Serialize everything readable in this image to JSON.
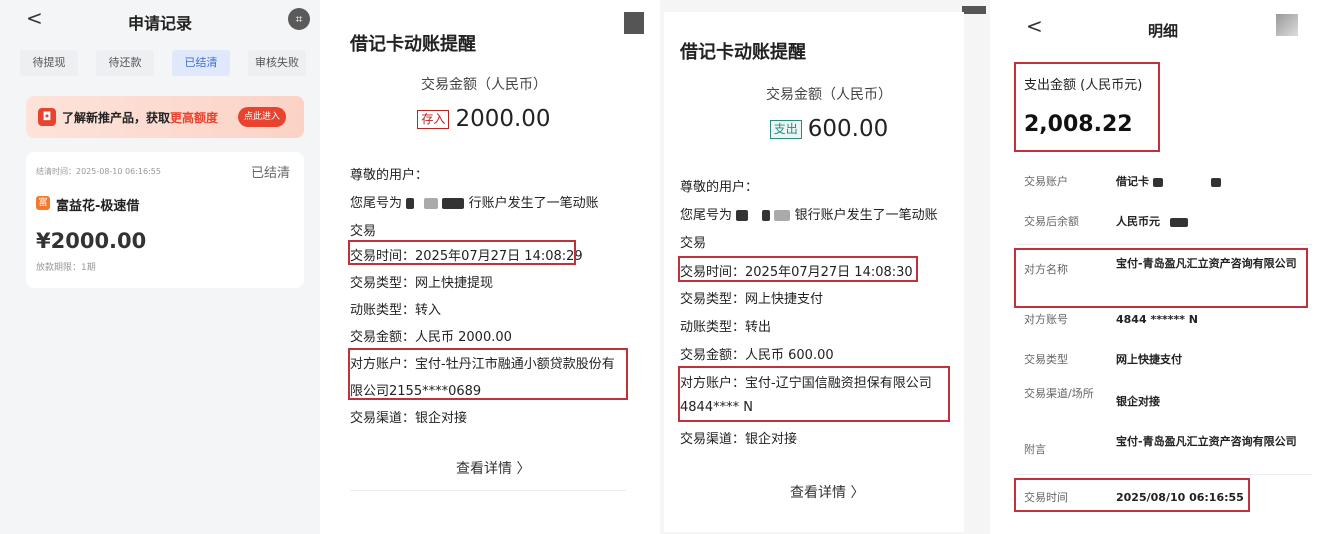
{
  "panel1": {
    "back": "<",
    "title": "申请记录",
    "scan_icon": "scan-icon",
    "tabs": [
      "待提现",
      "待还款",
      "已结清",
      "审核失败"
    ],
    "active_tab": 2,
    "promo": {
      "text_pre": "了解新推产品，获取",
      "text_hl": "更高额度",
      "button": "点此进入"
    },
    "record": {
      "settle_time": "结清时间：2025-08-10 06:16:55",
      "status": "已结清",
      "product": "富益花-极速借",
      "amount": "¥2000.00",
      "period": "放款期限：1期"
    }
  },
  "panel2": {
    "title": "借记卡动账提醒",
    "sub": "交易金额（人民币）",
    "tag": "存入",
    "amount": "2000.00",
    "greeting": "尊敬的用户：",
    "msg_pre": "您尾号为",
    "msg_mid": "行账户发生了一笔动账",
    "msg_end": "交易",
    "time": "交易时间：2025年07月27日 14:08:29",
    "type": "交易类型：网上快捷提现",
    "direction": "动账类型：转入",
    "tx_amount": "交易金额：人民币 2000.00",
    "counterparty_1": "对方账户：宝付-牡丹江市融通小额贷款股份有",
    "counterparty_2": "限公司2155****0689",
    "channel": "交易渠道：银企对接",
    "more": "查看详情 〉"
  },
  "panel3": {
    "title": "借记卡动账提醒",
    "sub": "交易金额（人民币）",
    "tag": "支出",
    "amount": "600.00",
    "greeting": "尊敬的用户：",
    "msg_pre": "您尾号为",
    "msg_mid": "银行账户发生了一笔动账",
    "msg_end": "交易",
    "time": "交易时间：2025年07月27日 14:08:30",
    "type": "交易类型：网上快捷支付",
    "direction": "动账类型：转出",
    "tx_amount": "交易金额：人民币 600.00",
    "counterparty_1": "对方账户：宝付-辽宁国信融资担保有限公司",
    "counterparty_2": "4844****  N",
    "channel": "交易渠道：银企对接",
    "more": "查看详情 〉"
  },
  "panel4": {
    "back": "<",
    "title": "明细",
    "expense_label": "支出金额 (人民币元)",
    "expense_amount": "2,008.22",
    "rows": [
      {
        "label": "交易账户",
        "value": "借记卡"
      },
      {
        "label": "交易后余额",
        "value": "人民币元"
      },
      {
        "label": "对方名称",
        "value": "宝付-青岛盈凡汇立资产咨询有限公司"
      },
      {
        "label": "对方账号",
        "value": "4844 ****** N"
      },
      {
        "label": "交易类型",
        "value": "网上快捷支付"
      },
      {
        "label": "交易渠道/场所",
        "value": "银企对接"
      },
      {
        "label": "附言",
        "value": "宝付-青岛盈凡汇立资产咨询有限公司"
      },
      {
        "label": "交易时间",
        "value": "2025/08/10 06:16:55"
      }
    ]
  },
  "colors": {
    "highlight_box": "#c0323a",
    "accent_blue": "#3b6fd8",
    "promo_red": "#e8432f"
  }
}
